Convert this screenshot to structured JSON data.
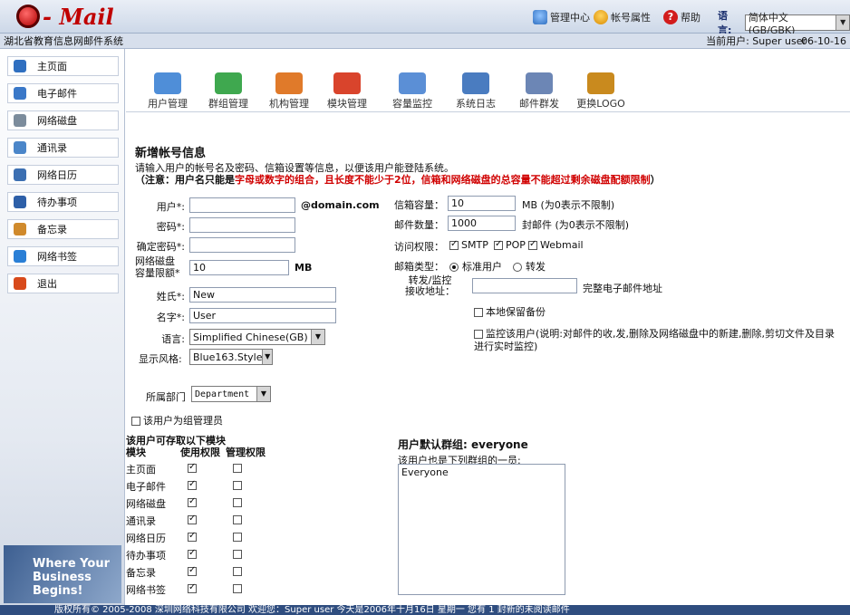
{
  "brand": {
    "logo_text": "- Mail"
  },
  "topbar": {
    "admin_center": "管理中心",
    "account_props": "帐号属性",
    "help": "帮助",
    "help_glyph": "?",
    "language_label": "语言:",
    "language_value": "简体中文(GB/GBK)"
  },
  "subbar": {
    "system_name": "湖北省教育信息网邮件系统",
    "current_user": "当前用户: Super user",
    "date": "06-10-16"
  },
  "sidebar": {
    "items": [
      {
        "label": "主页面",
        "icon": "home-icon",
        "color": "#2f6fc0"
      },
      {
        "label": "电子邮件",
        "icon": "mail-icon",
        "color": "#3a78c8"
      },
      {
        "label": "网络磁盘",
        "icon": "disk-icon",
        "color": "#7c8c9c"
      },
      {
        "label": "通讯录",
        "icon": "contacts-icon",
        "color": "#4b86c9"
      },
      {
        "label": "网络日历",
        "icon": "calendar-icon",
        "color": "#3c6fb2"
      },
      {
        "label": "待办事项",
        "icon": "todo-icon",
        "color": "#2d5fa8"
      },
      {
        "label": "备忘录",
        "icon": "memo-icon",
        "color": "#d08a2c"
      },
      {
        "label": "网络书签",
        "icon": "bookmark-icon",
        "color": "#2a7fd6"
      },
      {
        "label": "退出",
        "icon": "exit-icon",
        "color": "#d84a1b"
      }
    ],
    "promo_text": "Where Your Business Begins!"
  },
  "toolbar": {
    "items": [
      {
        "label": "用户管理",
        "icon": "user-manage-icon",
        "color": "#4f8ed8"
      },
      {
        "label": "群组管理",
        "icon": "group-manage-icon",
        "color": "#3fa84f"
      },
      {
        "label": "机构管理",
        "icon": "org-manage-icon",
        "color": "#e07a2a"
      },
      {
        "label": "模块管理",
        "icon": "module-manage-icon",
        "color": "#d9442c"
      },
      {
        "label": "容量监控",
        "icon": "capacity-monitor-icon",
        "color": "#5b8fd6"
      },
      {
        "label": "系统日志",
        "icon": "system-log-icon",
        "color": "#4a7cc0"
      },
      {
        "label": "邮件群发",
        "icon": "mass-mail-icon",
        "color": "#6c86b5"
      },
      {
        "label": "更换LOGO",
        "icon": "change-logo-icon",
        "color": "#c98a1e"
      }
    ]
  },
  "form": {
    "title": "新增帐号信息",
    "intro": "请输入用户的帐号名及密码、信箱设置等信息，以便该用户能登陆系统。",
    "note_prefix": "（注意：用户名只能是",
    "note_red": "字母或数字的组合，且长度不能少于2位，信箱和网络磁盘的总容量不能超过剩余磁盘配额限制",
    "note_suffix": "）",
    "user_label": "用户*:",
    "user_value": "",
    "domain_suffix": "@domain.com",
    "password_label": "密码*:",
    "confirm_label": "确定密码*:",
    "netdisk_label": "网络磁盘\n容量限额*",
    "netdisk_value": "10",
    "netdisk_unit": "MB",
    "lastname_label": "姓氏*:",
    "lastname_value": "New",
    "firstname_label": "名字*:",
    "firstname_value": "User",
    "language_label": "语言:",
    "language_value": "Simplified Chinese(GB)",
    "style_label": "显示风格:",
    "style_value": "Blue163.Style",
    "dept_label": "所属部门",
    "dept_value": "Department",
    "group_admin_label": "该用户为组管理员",
    "mailbox_size_label": "信箱容量：",
    "mailbox_size_value": "10",
    "mailbox_size_hint": "MB (为0表示不限制)",
    "mail_count_label": "邮件数量：",
    "mail_count_value": "1000",
    "mail_count_hint": "封邮件 (为0表示不限制)",
    "access_label": "访问权限：",
    "access_smtp": "SMTP",
    "access_pop": "POP",
    "access_webmail": "Webmail",
    "mailbox_type_label": "邮箱类型：",
    "type_standard": "标准用户",
    "type_forward": "转发",
    "forward_label": "转发/监控\n接收地址：",
    "forward_value": "",
    "forward_hint": "完整电子邮件地址",
    "local_backup_label": "本地保留备份",
    "monitor_label": "监控该用户(说明:对邮件的收,发,删除及网络磁盘中的新建,删除,剪切文件及目录进行实时监控)"
  },
  "permissions": {
    "heading": "该用户可存取以下模块",
    "col_module": "模块",
    "col_use": "使用权限",
    "col_manage": "管理权限",
    "rows": [
      {
        "module": "主页面",
        "use": true,
        "manage": false
      },
      {
        "module": "电子邮件",
        "use": true,
        "manage": false
      },
      {
        "module": "网络磁盘",
        "use": true,
        "manage": false
      },
      {
        "module": "通讯录",
        "use": true,
        "manage": false
      },
      {
        "module": "网络日历",
        "use": true,
        "manage": false
      },
      {
        "module": "待办事项",
        "use": true,
        "manage": false
      },
      {
        "module": "备忘录",
        "use": true,
        "manage": false
      },
      {
        "module": "网络书签",
        "use": true,
        "manage": false
      }
    ]
  },
  "default_group": {
    "heading": "用户默认群组: everyone",
    "subtext": "该用户也是下列群组的一员:",
    "members": [
      "Everyone"
    ]
  },
  "footer": {
    "text": "版权所有© 2005-2008 深圳网络科技有限公司        欢迎您：Super user 今天是2006年十月16日 星期一    您有 1 封新的未阅读邮件"
  }
}
